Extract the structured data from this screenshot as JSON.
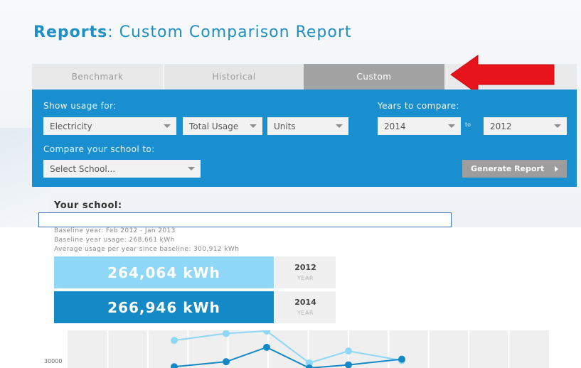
{
  "page": {
    "title_bold": "Reports",
    "title_rest": ": Custom Comparison Report"
  },
  "tabs": [
    {
      "label": "Benchmark"
    },
    {
      "label": "Historical"
    },
    {
      "label": "Custom",
      "active": true
    },
    {
      "label": ""
    }
  ],
  "filters": {
    "show_usage_label": "Show usage for:",
    "energy_type": "Electricity",
    "usage_type": "Total Usage",
    "units": "Units",
    "years_label": "Years to compare:",
    "year_from": "2014",
    "to_label": "to",
    "year_to": "2012",
    "compare_label": "Compare your school to:",
    "school_select": "Select School...",
    "generate_label": "Generate Report"
  },
  "school": {
    "heading": "Your school:",
    "name_value": "",
    "baseline_year": "Baseline year: Feb 2012 - Jan 2013",
    "baseline_usage": "Baseline year usage: 268,661 kWh",
    "average_usage": "Average usage per year since baseline: 300,912 kWh"
  },
  "comparisons": [
    {
      "value": "264,064 kWh",
      "year": "2012",
      "year_label": "YEAR"
    },
    {
      "value": "266,946 kWh",
      "year": "2014",
      "year_label": "YEAR"
    }
  ],
  "chart_data": {
    "type": "line",
    "y_tick_visible": "30000",
    "series": [
      {
        "color": "#8fd7f7",
        "points": [
          [
            0,
            44
          ],
          [
            1,
            55
          ],
          [
            2,
            59
          ],
          [
            3,
            8
          ],
          [
            4,
            27
          ],
          [
            5,
            12
          ]
        ]
      },
      {
        "color": "#1489c6",
        "points": [
          [
            0,
            2
          ],
          [
            1,
            10
          ],
          [
            2,
            33
          ],
          [
            3,
            0
          ],
          [
            4,
            5
          ],
          [
            5,
            14
          ]
        ]
      }
    ]
  },
  "colors": {
    "brand_blue": "#1a8fcf",
    "light_blue": "#8fd7f7",
    "dark_blue": "#1489c6",
    "arrow_red": "#e8141c"
  }
}
